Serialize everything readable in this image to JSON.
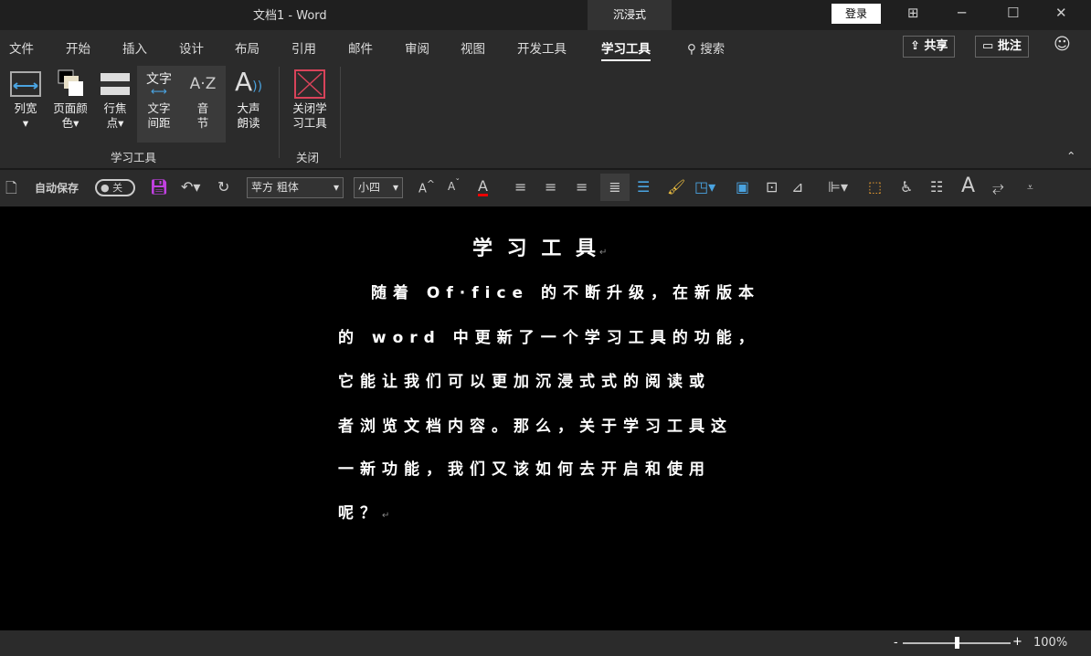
{
  "title": "文档1  -  Word",
  "immersive": "沉浸式",
  "login": "登录",
  "window": {
    "layout": "⊞",
    "min": "─",
    "max": "☐",
    "close": "✕"
  },
  "tabs": [
    "文件",
    "开始",
    "插入",
    "设计",
    "布局",
    "引用",
    "邮件",
    "审阅",
    "视图",
    "开发工具",
    "学习工具"
  ],
  "search": "搜索",
  "share": "共享",
  "comment": "批注",
  "ribbon": {
    "buttons": [
      {
        "l1": "列宽",
        "l2": "▾"
      },
      {
        "l1": "页面颜",
        "l2": "色▾"
      },
      {
        "l1": "行焦",
        "l2": "点▾"
      },
      {
        "l1": "文字",
        "l2": "间距"
      },
      {
        "l1": "音",
        "l2": "节"
      },
      {
        "l1": "大声",
        "l2": "朗读"
      },
      {
        "l1": "关闭学",
        "l2": "习工具"
      }
    ],
    "icon_text": {
      "spacing": "文字",
      "syllable": "A·Z"
    },
    "group1": "学习工具",
    "group2": "关闭"
  },
  "toolbar": {
    "autosave": "自动保存",
    "toggle": "关",
    "font": "苹方 粗体",
    "size": "小四"
  },
  "doc": {
    "heading": "学 习 工 具",
    "lines": [
      "随着 Of·fice 的不断升级，在新版本",
      "的 word 中更新了一个学习工具的功能，",
      "它能让我们可以更加沉浸式式的阅读或",
      "者浏览文档内容。那么，关于学习工具这",
      "一新功能，我们又该如何去开启和使用",
      "呢？"
    ]
  },
  "status": {
    "zoom": "100%",
    "zoom_value": 100
  }
}
